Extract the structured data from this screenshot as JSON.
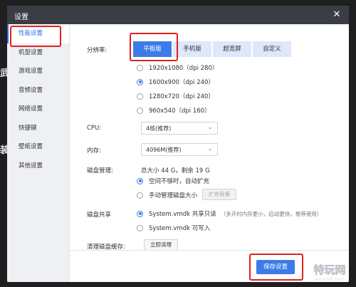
{
  "background": {
    "left_chars": [
      "武",
      "装"
    ]
  },
  "window": {
    "title": "设置",
    "close_icon": "close-icon"
  },
  "sidebar": {
    "items": [
      {
        "label": "性能设置",
        "active": true
      },
      {
        "label": "机型设置",
        "active": false
      },
      {
        "label": "游戏设置",
        "active": false
      },
      {
        "label": "音频设置",
        "active": false
      },
      {
        "label": "网络设置",
        "active": false
      },
      {
        "label": "快捷键",
        "active": false
      },
      {
        "label": "壁纸设置",
        "active": false
      },
      {
        "label": "其他设置",
        "active": false
      }
    ]
  },
  "resolution": {
    "label": "分辨率:",
    "tabs": [
      {
        "label": "平板版",
        "active": true
      },
      {
        "label": "手机版",
        "active": false
      },
      {
        "label": "超宽屏",
        "active": false
      },
      {
        "label": "自定义",
        "active": false
      }
    ],
    "options": [
      {
        "label": "1920x1080（dpi 280）",
        "checked": false
      },
      {
        "label": "1600x900（dpi 240）",
        "checked": true
      },
      {
        "label": "1280x720（dpi 240）",
        "checked": false
      },
      {
        "label": "960x540（dpi 160）",
        "checked": false
      }
    ]
  },
  "cpu": {
    "label": "CPU:",
    "value": "4核(推荐)"
  },
  "memory": {
    "label": "内存:",
    "value": "4096M(推荐)"
  },
  "disk": {
    "label": "磁盘管理:",
    "info": "总大小 44 G，剩余 19 G",
    "options": [
      {
        "label": "空间不够时，自动扩充",
        "checked": true
      },
      {
        "label": "手动管理磁盘大小",
        "checked": false
      }
    ],
    "expand_button": "扩充容量"
  },
  "disk_share": {
    "label": "磁盘共享",
    "options": [
      {
        "label": "System.vmdk 共享只读",
        "hint": "（多开时内存更小，启动更快，推荐使用）",
        "checked": true
      },
      {
        "label": "System.vmdk 可写入",
        "hint": "",
        "checked": false
      }
    ]
  },
  "cache": {
    "label": "清理磁盘缓存:",
    "button": "立即清理"
  },
  "footer": {
    "save_button": "保存设置"
  },
  "watermark": {
    "text": "特玩网",
    "url": "www.te5.com"
  },
  "colors": {
    "accent": "#3c7ce8",
    "highlight_box": "#e02020",
    "titlebar": "#3b3d45",
    "sidebar_bg": "#eef0f3"
  }
}
